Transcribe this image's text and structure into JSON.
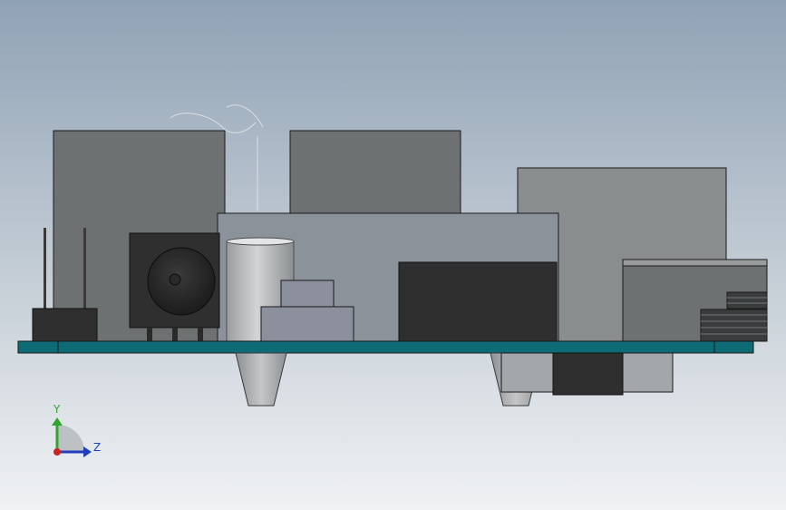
{
  "viewport": {
    "background_top": "#90a2b5",
    "background_bottom": "#f0f2f4"
  },
  "colors": {
    "pcb": "#0c6b74",
    "dark_component": "#2f2f2f",
    "medium_component": "#6e7171",
    "light_component": "#8a8d8e",
    "silver": "#b6b9bb",
    "outline": "#1a1a1a"
  },
  "triad": {
    "y_label": "Y",
    "z_label": "Z",
    "y_color": "#2fa52f",
    "z_color": "#1f3fbf",
    "origin_color": "#cc2222"
  }
}
